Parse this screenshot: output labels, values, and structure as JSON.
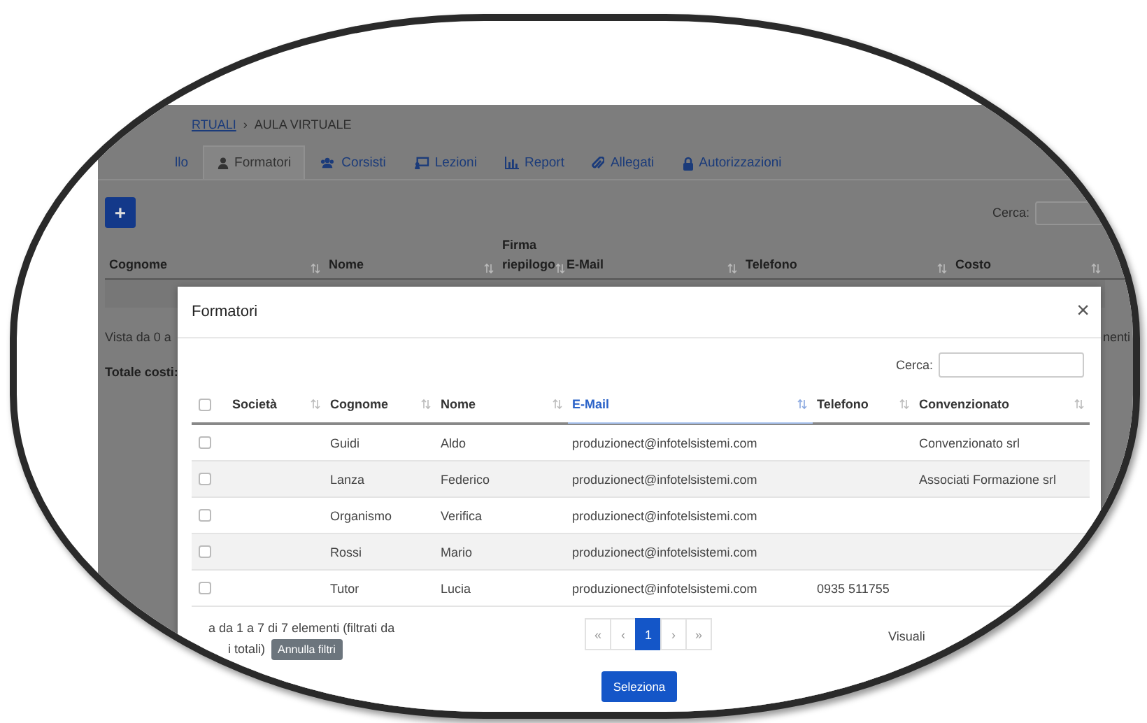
{
  "breadcrumb": {
    "link": "RTUALI",
    "separator": "›",
    "current": "AULA VIRTUALE"
  },
  "tabs": [
    {
      "label": "llo",
      "kind": "plain",
      "selected": false
    },
    {
      "label": "Formatori",
      "kind": "user",
      "selected": true
    },
    {
      "label": "Corsisti",
      "kind": "users",
      "selected": false
    },
    {
      "label": "Lezioni",
      "kind": "board",
      "selected": false
    },
    {
      "label": "Report",
      "kind": "chart",
      "selected": false
    },
    {
      "label": "Allegati",
      "kind": "clip",
      "selected": false
    },
    {
      "label": "Autorizzazioni",
      "kind": "lock",
      "selected": false
    }
  ],
  "add_button": "+",
  "search": {
    "label": "Cerca:"
  },
  "table": {
    "columns": [
      "Cognome",
      "Nome",
      "Firma riepilogo",
      "E-Mail",
      "Telefono",
      "Costo"
    ]
  },
  "info": "Vista da 0 a",
  "info_right": "nenti",
  "total_label": "Totale costi:",
  "modal": {
    "title": "Formatori",
    "close": "×",
    "search": {
      "label": "Cerca:"
    },
    "select_all": {
      "checked": false
    },
    "columns": [
      {
        "label": "Società",
        "sorted": false
      },
      {
        "label": "Cognome",
        "sorted": false
      },
      {
        "label": "Nome",
        "sorted": false
      },
      {
        "label": "E-Mail",
        "sorted": true
      },
      {
        "label": "Telefono",
        "sorted": false
      },
      {
        "label": "Convenzionato",
        "sorted": false
      }
    ],
    "rows": [
      {
        "checked": false,
        "cells": [
          "",
          "Guidi",
          "Aldo",
          "produzionect@infotelsistemi.com",
          "",
          "Convenzionato srl"
        ]
      },
      {
        "checked": false,
        "cells": [
          "",
          "Lanza",
          "Federico",
          "produzionect@infotelsistemi.com",
          "",
          "Associati Formazione srl"
        ]
      },
      {
        "checked": false,
        "cells": [
          "",
          "Organismo",
          "Verifica",
          "produzionect@infotelsistemi.com",
          "",
          ""
        ]
      },
      {
        "checked": false,
        "cells": [
          "",
          "Rossi",
          "Mario",
          "produzionect@infotelsistemi.com",
          "",
          ""
        ]
      },
      {
        "checked": false,
        "cells": [
          "",
          "Tutor",
          "Lucia",
          "produzionect@infotelsistemi.com",
          "0935 511755",
          ""
        ]
      }
    ],
    "info_line1": "a da 1 a 7 di 7 elementi (filtrati da",
    "info_line2": "i totali)",
    "reset_button": "Annulla filtri",
    "pages": [
      {
        "label": "«",
        "selected": false
      },
      {
        "label": "‹",
        "selected": false
      },
      {
        "label": "1",
        "selected": true
      },
      {
        "label": "›",
        "selected": false
      },
      {
        "label": "»",
        "selected": false
      }
    ],
    "length_label": "Visuali",
    "select_button": "Seleziona"
  }
}
